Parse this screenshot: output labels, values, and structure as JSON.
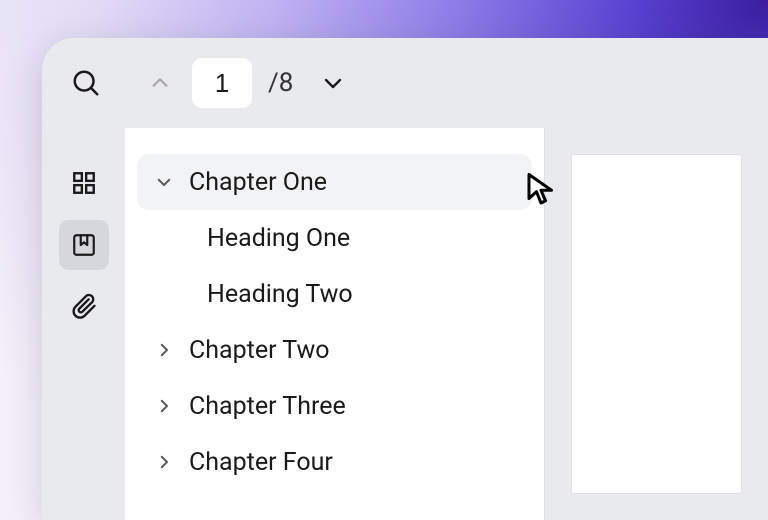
{
  "pager": {
    "current": "1",
    "total": "/8"
  },
  "outline": {
    "items": [
      {
        "label": "Chapter One",
        "expanded": true,
        "children": [
          {
            "label": "Heading One"
          },
          {
            "label": "Heading Two"
          }
        ]
      },
      {
        "label": "Chapter Two",
        "expanded": false
      },
      {
        "label": "Chapter Three",
        "expanded": false
      },
      {
        "label": "Chapter Four",
        "expanded": false
      }
    ]
  }
}
